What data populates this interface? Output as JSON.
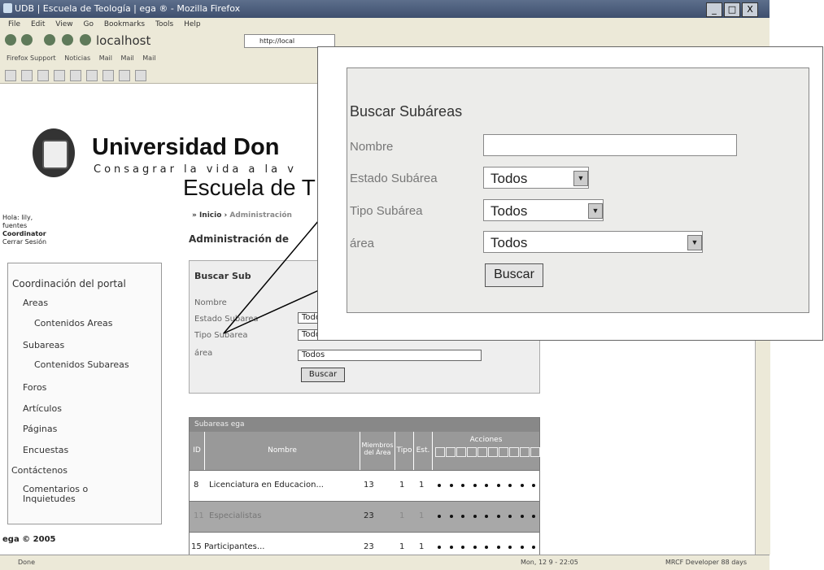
{
  "window": {
    "title": "UDB | Escuela de Teología | ega ® - Mozilla Firefox",
    "controls": [
      "_",
      "□",
      "X"
    ]
  },
  "menubar": [
    "File",
    "Edit",
    "View",
    "Go",
    "Bookmarks",
    "Tools",
    "Help"
  ],
  "navbar": {
    "host_label": "localhost",
    "address": "http://local"
  },
  "bookmarks": [
    "Firefox Support",
    "Noticias",
    "Mail",
    "Mail",
    "Mail"
  ],
  "site": {
    "university": "Universidad Don",
    "motto": "Consagrar la vida a la v",
    "school": "Escuela de T"
  },
  "user": {
    "greeting": "Hola: lily,",
    "name": "fuentes",
    "role": "Coordinator",
    "logout": "Cerrar Sesión"
  },
  "breadcrumb": {
    "home": "» Inicio ›",
    "current": "Administración"
  },
  "admin_title": "Administración de",
  "sidebar": {
    "title": "Coordinación del portal",
    "items": [
      {
        "label": "Areas"
      },
      {
        "label": "Contenidos Areas"
      },
      {
        "label": "Subareas"
      },
      {
        "label": "Contenidos Subareas"
      },
      {
        "label": "Foros"
      },
      {
        "label": "Artículos"
      },
      {
        "label": "Páginas"
      },
      {
        "label": "Encuestas"
      },
      {
        "label": "Contáctenos"
      },
      {
        "label": "Comentarios o Inquietudes"
      }
    ]
  },
  "search_small": {
    "title": "Buscar Sub",
    "labels": [
      "Nombre",
      "Estado Subarea",
      "Tipo Subarea",
      "área"
    ],
    "values": [
      "Todos",
      "Todos",
      "Todos"
    ],
    "button": "Buscar"
  },
  "grid": {
    "header": "Subareas ega",
    "columns": [
      "ID",
      "Nombre",
      "Miembros del Área",
      "Tipo",
      "Est.",
      "Acciones"
    ],
    "rows": [
      {
        "id": "8",
        "nombre": "Licenciatura en Educacion...",
        "miembros": "13",
        "tipo": "1",
        "est": "1"
      },
      {
        "id": "11",
        "nombre": "Especialistas",
        "miembros": "23",
        "tipo": "1",
        "est": "1"
      },
      {
        "id": "15",
        "nombre": "Participantes...",
        "miembros": "23",
        "tipo": "1",
        "est": "1"
      }
    ]
  },
  "footer": "ega © 2005",
  "status": {
    "left": "Done",
    "datetime": "Mon, 12 9 - 22:05",
    "right": "MRCF Developer 88 days"
  },
  "zoom_panel": {
    "title": "Buscar Subáreas",
    "labels": [
      "Nombre",
      "Estado Subárea",
      "Tipo Subárea",
      "área"
    ],
    "values": [
      "Todos",
      "Todos",
      "Todos"
    ],
    "button": "Buscar"
  }
}
